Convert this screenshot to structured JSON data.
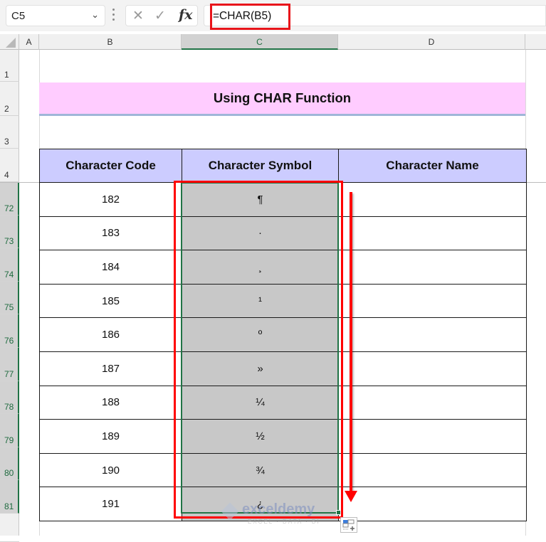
{
  "formula_bar": {
    "name_box": "C5",
    "cancel_icon": "✕",
    "enter_icon": "✓",
    "fx_label": "fx",
    "formula": "=CHAR(B5)"
  },
  "columns": [
    "A",
    "B",
    "C",
    "D"
  ],
  "rows_top": [
    "1",
    "2",
    "3",
    "4"
  ],
  "rows_data": [
    "72",
    "73",
    "74",
    "75",
    "76",
    "77",
    "78",
    "79",
    "80",
    "81"
  ],
  "title": "Using CHAR Function",
  "table": {
    "headers": [
      "Character Code",
      "Character Symbol",
      "Character Name"
    ],
    "rows": [
      {
        "code": "182",
        "symbol": "¶",
        "name": ""
      },
      {
        "code": "183",
        "symbol": "·",
        "name": ""
      },
      {
        "code": "184",
        "symbol": "¸",
        "name": ""
      },
      {
        "code": "185",
        "symbol": "¹",
        "name": ""
      },
      {
        "code": "186",
        "symbol": "º",
        "name": ""
      },
      {
        "code": "187",
        "symbol": "»",
        "name": ""
      },
      {
        "code": "188",
        "symbol": "¼",
        "name": ""
      },
      {
        "code": "189",
        "symbol": "½",
        "name": ""
      },
      {
        "code": "190",
        "symbol": "¾",
        "name": ""
      },
      {
        "code": "191",
        "symbol": "¿",
        "name": ""
      }
    ]
  },
  "watermark": {
    "brand": "exceldemy",
    "tagline": "EXCEL · DATA · BI"
  },
  "colors": {
    "title_fill": "#ffccff",
    "header_fill": "#ccccff",
    "selection_green": "#217346",
    "annotation_red": "#ff0000"
  }
}
